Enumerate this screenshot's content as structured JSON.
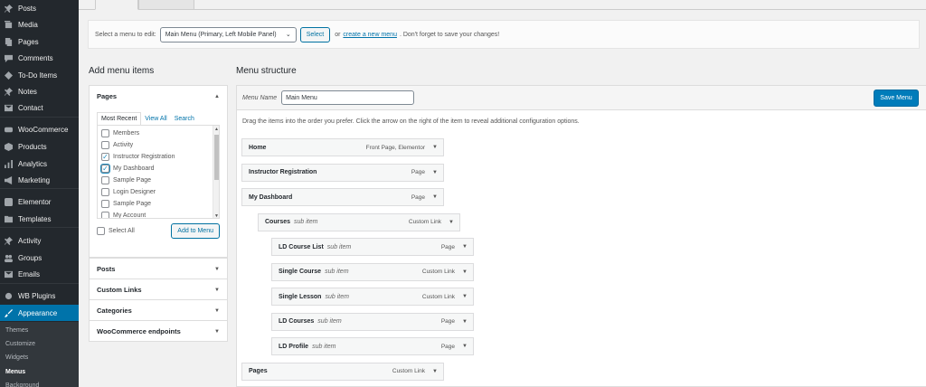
{
  "sidebar": {
    "items": [
      {
        "label": "Posts",
        "icon": "pin-icon"
      },
      {
        "label": "Media",
        "icon": "media-icon"
      },
      {
        "label": "Pages",
        "icon": "pages-icon"
      },
      {
        "label": "Comments",
        "icon": "comment-icon"
      },
      {
        "label": "To-Do Items",
        "icon": "todo-icon"
      },
      {
        "label": "Notes",
        "icon": "pin-icon"
      },
      {
        "label": "Contact",
        "icon": "mail-icon"
      },
      {
        "label": "WooCommerce",
        "icon": "woocommerce-icon"
      },
      {
        "label": "Products",
        "icon": "box-icon"
      },
      {
        "label": "Analytics",
        "icon": "bar-chart-icon"
      },
      {
        "label": "Marketing",
        "icon": "megaphone-icon"
      },
      {
        "label": "Elementor",
        "icon": "elementor-icon"
      },
      {
        "label": "Templates",
        "icon": "folder-icon"
      },
      {
        "label": "Activity",
        "icon": "activity-icon"
      },
      {
        "label": "Groups",
        "icon": "groups-icon"
      },
      {
        "label": "Emails",
        "icon": "mail-icon"
      },
      {
        "label": "WB Plugins",
        "icon": "plugin-icon"
      },
      {
        "label": "Appearance",
        "icon": "paintbrush-icon"
      }
    ],
    "submenu": [
      "Themes",
      "Customize",
      "Widgets",
      "Menus",
      "Background"
    ]
  },
  "manage": {
    "select_label": "Select a menu to edit:",
    "selected_menu": "Main Menu (Primary, Left Mobile Panel)",
    "select_button": "Select",
    "or_text": "or",
    "create_link": "create a new menu",
    "reminder": ". Don't forget to save your changes!"
  },
  "add_items": {
    "heading": "Add menu items",
    "pages_title": "Pages",
    "tabs": [
      "Most Recent",
      "View All",
      "Search"
    ],
    "pages": [
      {
        "label": "Members",
        "checked": false
      },
      {
        "label": "Activity",
        "checked": false
      },
      {
        "label": "Instructor Registration",
        "checked": true
      },
      {
        "label": "My Dashboard",
        "checked": true
      },
      {
        "label": "Sample Page",
        "checked": false
      },
      {
        "label": "Login Designer",
        "checked": false
      },
      {
        "label": "Sample Page",
        "checked": false
      },
      {
        "label": "My Account",
        "checked": false
      }
    ],
    "check_mark": "✓",
    "select_all": "Select All",
    "add_button": "Add to Menu",
    "sections": [
      "Posts",
      "Custom Links",
      "Categories",
      "WooCommerce endpoints"
    ]
  },
  "structure": {
    "heading": "Menu structure",
    "name_label": "Menu Name",
    "menu_name": "Main Menu",
    "save_button": "Save Menu",
    "instructions": "Drag the items into the order you prefer. Click the arrow on the right of the item to reveal additional configuration options.",
    "items": [
      {
        "title": "Home",
        "sub": "",
        "type": "Front Page, Elementor",
        "depth": 0
      },
      {
        "title": "Instructor Registration",
        "sub": "",
        "type": "Page",
        "depth": 0
      },
      {
        "title": "My Dashboard",
        "sub": "",
        "type": "Page",
        "depth": 0
      },
      {
        "title": "Courses",
        "sub": "sub item",
        "type": "Custom Link",
        "depth": 1
      },
      {
        "title": "LD Course List",
        "sub": "sub item",
        "type": "Page",
        "depth": 2
      },
      {
        "title": "Single Course",
        "sub": "sub item",
        "type": "Custom Link",
        "depth": 2
      },
      {
        "title": "Single Lesson",
        "sub": "sub item",
        "type": "Custom Link",
        "depth": 2
      },
      {
        "title": "LD Courses",
        "sub": "sub item",
        "type": "Page",
        "depth": 2
      },
      {
        "title": "LD Profile",
        "sub": "sub item",
        "type": "Page",
        "depth": 2
      },
      {
        "title": "Pages",
        "sub": "",
        "type": "Custom Link",
        "depth": 0
      }
    ]
  },
  "colors": {
    "admin_bg": "#23282d",
    "accent": "#0073aa",
    "button_primary": "#007cba"
  }
}
